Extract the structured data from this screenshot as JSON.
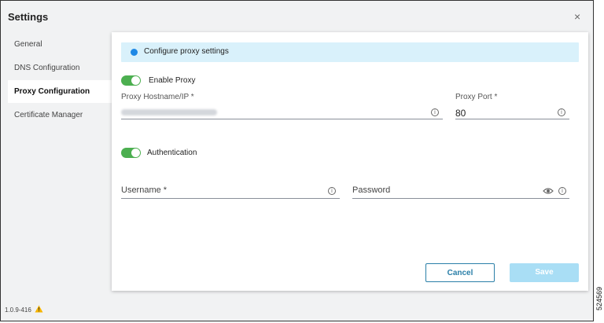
{
  "window": {
    "title": "Settings",
    "close_glyph": "×"
  },
  "nav": {
    "items": [
      {
        "label": "General"
      },
      {
        "label": "DNS Configuration"
      },
      {
        "label": "Proxy Configuration",
        "active": true
      },
      {
        "label": "Certificate Manager"
      }
    ]
  },
  "banner": {
    "text": "Configure proxy settings",
    "icon": "info-icon",
    "color": "#d9f1fb"
  },
  "proxy": {
    "enable_label": "Enable Proxy",
    "enabled": true,
    "hostname_label": "Proxy Hostname/IP *",
    "port_label": "Proxy Port *",
    "port_value": "80"
  },
  "auth": {
    "label": "Authentication",
    "enabled": true,
    "username_label": "Username *",
    "password_label": "Password"
  },
  "buttons": {
    "cancel": "Cancel",
    "save": "Save"
  },
  "footer": {
    "version": "1.0.9-416",
    "warning_icon": "warning-icon"
  },
  "figure_id": "524569",
  "colors": {
    "accent": "#2a7fa8",
    "toggle_on": "#4caf50",
    "save_disabled": "#a9def5"
  }
}
